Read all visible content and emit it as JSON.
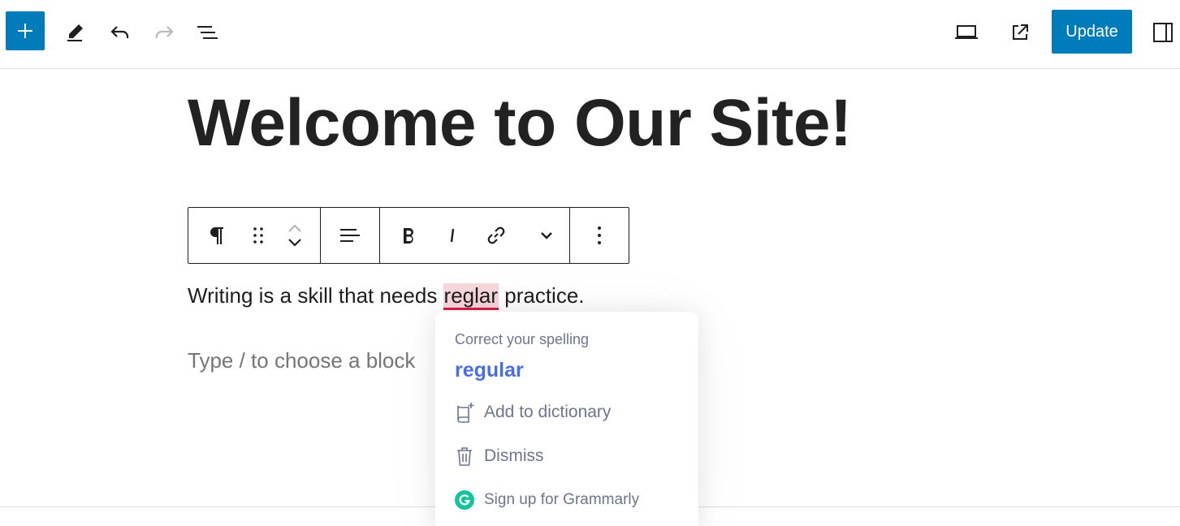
{
  "toolbar": {
    "add_block_icon": "plus-icon",
    "tools_icon": "pencil-icon",
    "undo_icon": "undo-icon",
    "redo_icon": "redo-icon",
    "list_view_icon": "list-view-icon",
    "preview_icon": "laptop-icon",
    "view_post_icon": "external-link-icon",
    "update_label": "Update",
    "settings_icon": "sidebar-toggle-icon"
  },
  "editor": {
    "title": "Welcome to Our Site!",
    "paragraph_before": "Writing is a skill that needs ",
    "misspelled_word": "reglar",
    "paragraph_after": " practice.",
    "placeholder": "Type / to choose a block"
  },
  "block_toolbar": {
    "icons": [
      "pilcrow-icon",
      "drag-handle-icon",
      "move-up-icon",
      "move-down-icon",
      "align-icon",
      "bold-icon",
      "italic-icon",
      "link-icon",
      "chevron-down-icon",
      "more-options-icon"
    ]
  },
  "grammarly": {
    "heading": "Correct your spelling",
    "suggestion": "regular",
    "add_to_dictionary": "Add to dictionary",
    "dismiss": "Dismiss",
    "sign_up": "Sign up for Grammarly"
  },
  "colors": {
    "accent": "#007cba",
    "misspelling_underline": "#d6214c",
    "suggestion": "#4a6ee0",
    "grammarly_green": "#15c39a"
  }
}
